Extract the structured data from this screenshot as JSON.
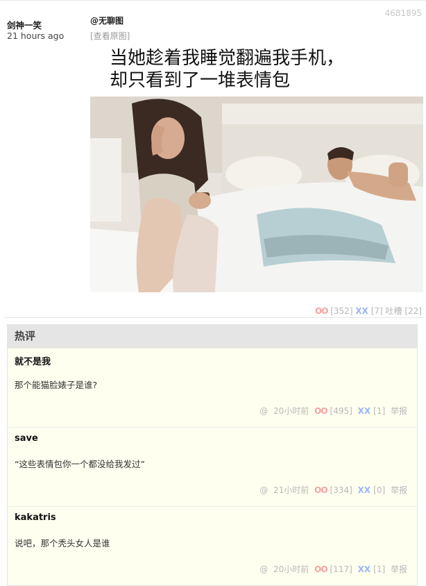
{
  "post": {
    "author": "剑神一笑",
    "time": "21 hours ago",
    "id": "4681895",
    "mention": "@无聊图",
    "view_original": "[查看原图]",
    "meme_caption": "当她趁着我睡觉翻遍我手机，\n却只看到了一堆表情包",
    "oo_label": "OO",
    "oo_count": "[352]",
    "xx_label": "XX",
    "xx_count": "[7]",
    "tucao_label": "吐槽",
    "tucao_count": "[22]"
  },
  "hot": {
    "title": "热评",
    "comments": [
      {
        "author": "就不是我",
        "text": "那个能猫脸婊子是谁?",
        "at": "@",
        "time": "20小时前",
        "oo_label": "OO",
        "oo": "[495]",
        "xx_label": "XX",
        "xx": "[1]",
        "report": "举报"
      },
      {
        "author": "save",
        "text": "“这些表情包你一个都没给我发过”",
        "at": "@",
        "time": "21小时前",
        "oo_label": "OO",
        "oo": "[334]",
        "xx_label": "XX",
        "xx": "[0]",
        "report": "举报"
      },
      {
        "author": "kakatris",
        "text": "说吧，那个秃头女人是谁",
        "at": "@",
        "time": "20小时前",
        "oo_label": "OO",
        "oo": "[117]",
        "xx_label": "XX",
        "xx": "[1]",
        "report": "举报"
      }
    ]
  }
}
